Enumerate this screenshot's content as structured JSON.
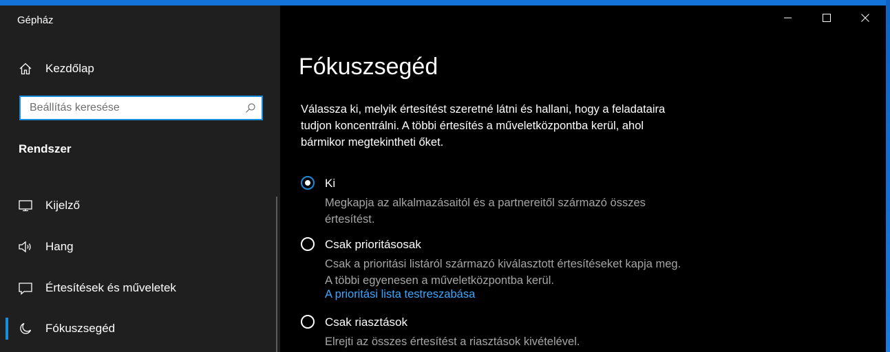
{
  "app": {
    "title": "Gépház"
  },
  "sidebar": {
    "home_label": "Kezdőlap",
    "search_placeholder": "Beállítás keresése",
    "section": "Rendszer",
    "items": [
      {
        "label": "Kijelző",
        "icon": "monitor-icon"
      },
      {
        "label": "Hang",
        "icon": "speaker-icon"
      },
      {
        "label": "Értesítések és műveletek",
        "icon": "message-icon"
      },
      {
        "label": "Fókuszsegéd",
        "icon": "moon-icon",
        "selected": true
      }
    ]
  },
  "titlebar": {
    "buttons": [
      "minimize-icon",
      "maximize-icon",
      "close-icon"
    ]
  },
  "main": {
    "title": "Fókuszsegéd",
    "description": "Válassza ki, melyik értesítést szeretné látni és hallani, hogy a feladataira tudjon koncentrálni. A többi értesítés a műveletközpontba kerül, ahol bármikor megtekintheti őket.",
    "options": [
      {
        "label": "Ki",
        "description": "Megkapja az alkalmazásaitól és a partnereitől származó összes értesítést.",
        "checked": true
      },
      {
        "label": "Csak prioritásosak",
        "description": "Csak a prioritási listáról származó kiválasztott értesítéseket kapja meg. A többi egyenesen a műveletközpontba kerül.",
        "link": "A prioritási lista testreszabása",
        "checked": false
      },
      {
        "label": "Csak riasztások",
        "description": "Elrejti az összes értesítést a riasztások kivételével.",
        "checked": false
      }
    ]
  },
  "colors": {
    "accent": "#1a8cdb",
    "link": "#3ea6ff",
    "sidebar_bg": "#1f1f1f",
    "content_bg": "#000000",
    "secondary_text": "#a6a6a6"
  }
}
